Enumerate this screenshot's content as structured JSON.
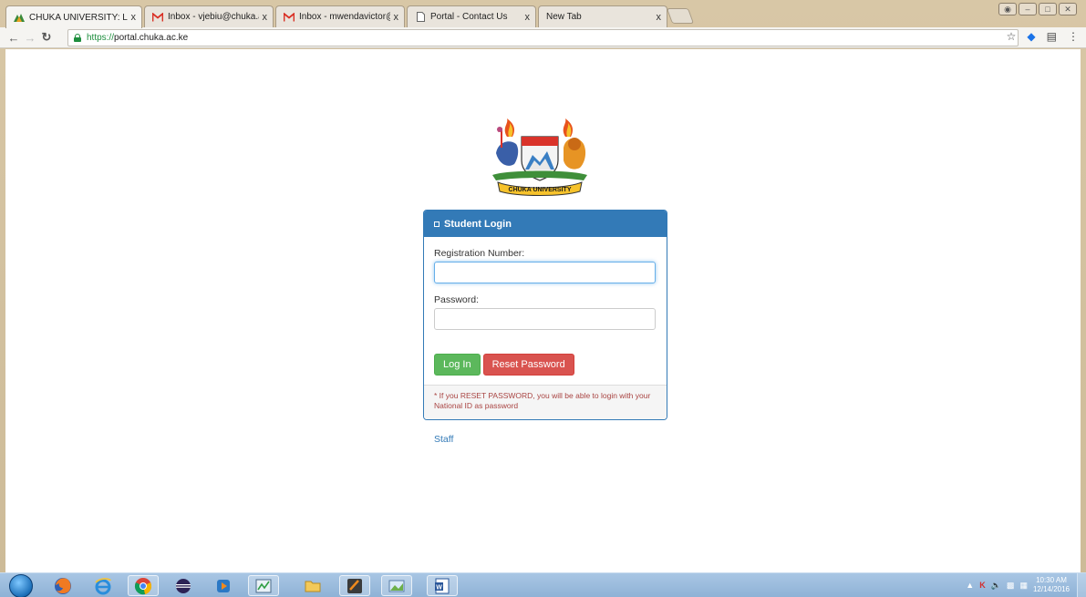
{
  "browser": {
    "tabs": [
      {
        "title": "CHUKA UNIVERSITY: Log",
        "icon": "chuka-favicon-icon",
        "active": true
      },
      {
        "title": "Inbox - vjebiu@chuka.ac",
        "icon": "gmail-icon",
        "active": false
      },
      {
        "title": "Inbox - mwendavictor@",
        "icon": "gmail-icon",
        "active": false
      },
      {
        "title": "Portal - Contact Us",
        "icon": "page-icon",
        "active": false
      },
      {
        "title": "New Tab",
        "icon": "",
        "active": false
      }
    ],
    "tab_close": "x",
    "url_scheme": "https://",
    "url_host": "portal.chuka.ac.ke"
  },
  "login": {
    "panel_title": "Student Login",
    "reg_label": "Registration Number:",
    "reg_value": "",
    "password_label": "Password:",
    "password_value": "",
    "login_button": "Log In",
    "reset_button": "Reset Password",
    "note": "* If you RESET PASSWORD, you will be able to login with your National ID as password",
    "staff_link": "Staff"
  },
  "logo": {
    "banner_text": "CHUKA UNIVERSITY"
  },
  "taskbar": {
    "time": "10:30 AM",
    "date": "12/14/2016"
  },
  "colors": {
    "primary": "#337ab7",
    "success": "#5cb85c",
    "danger": "#d9534f",
    "note_text": "#a94442"
  }
}
